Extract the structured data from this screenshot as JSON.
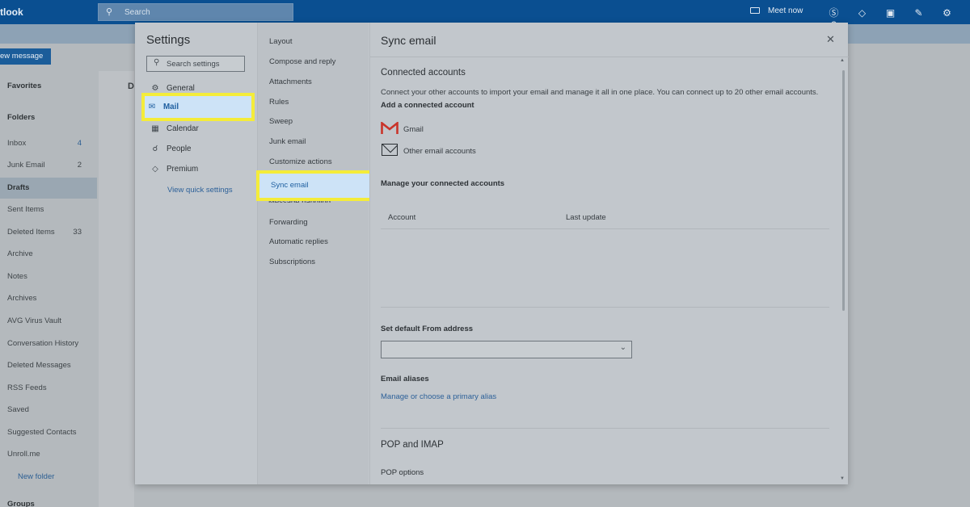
{
  "app": {
    "brand": "tlook",
    "search_placeholder": "Search",
    "meet_now": "Meet now",
    "top_icons": [
      "skype-icon",
      "diamond-icon",
      "office-icon",
      "feedback-icon",
      "gear-icon",
      "help-icon"
    ],
    "top_icon_glyphs": [
      "Ⓢ",
      "◇",
      "▣",
      "✎",
      "⚙",
      "?"
    ],
    "new_message": "ew message",
    "list_header": "D",
    "nav": {
      "favorites": "Favorites",
      "folders": "Folders",
      "inbox": "Inbox",
      "inbox_count": "4",
      "junk": "Junk Email",
      "junk_count": "2",
      "drafts": "Drafts",
      "sent": "Sent Items",
      "deleted": "Deleted Items",
      "deleted_count": "33",
      "archive": "Archive",
      "notes": "Notes",
      "archives": "Archives",
      "avg": "AVG Virus Vault",
      "conversation": "Conversation History",
      "deleted_messages": "Deleted Messages",
      "rss": "RSS Feeds",
      "saved": "Saved",
      "suggested": "Suggested Contacts",
      "unroll": "Unroll.me",
      "new_folder": "New folder",
      "groups": "Groups"
    }
  },
  "settings": {
    "title": "Settings",
    "search_placeholder": "Search settings",
    "categories": {
      "general": "General",
      "mail": "Mail",
      "calendar": "Calendar",
      "people": "People",
      "premium": "Premium"
    },
    "view_quick": "View quick settings",
    "mail_sub": {
      "layout": "Layout",
      "compose": "Compose and reply",
      "attachments": "Attachments",
      "rules": "Rules",
      "sweep": "Sweep",
      "junk": "Junk email",
      "customize": "Customize actions",
      "sync": "Sync email",
      "message_handling": "Message handling",
      "forwarding": "Forwarding",
      "auto_replies": "Automatic replies",
      "subscriptions": "Subscriptions"
    },
    "pane": {
      "title": "Sync email",
      "connected_heading": "Connected accounts",
      "connected_desc": "Connect your other accounts to import your email and manage it all in one place. You can connect up to 20 other email accounts.",
      "add_account": "Add a connected account",
      "gmail": "Gmail",
      "other_email": "Other email accounts",
      "manage_heading": "Manage your connected accounts",
      "col_account": "Account",
      "col_last_update": "Last update",
      "default_from": "Set default From address",
      "default_from_value": "",
      "email_aliases": "Email aliases",
      "manage_alias": "Manage or choose a primary alias",
      "pop_heading": "POP and IMAP",
      "pop_options": "POP options"
    }
  }
}
